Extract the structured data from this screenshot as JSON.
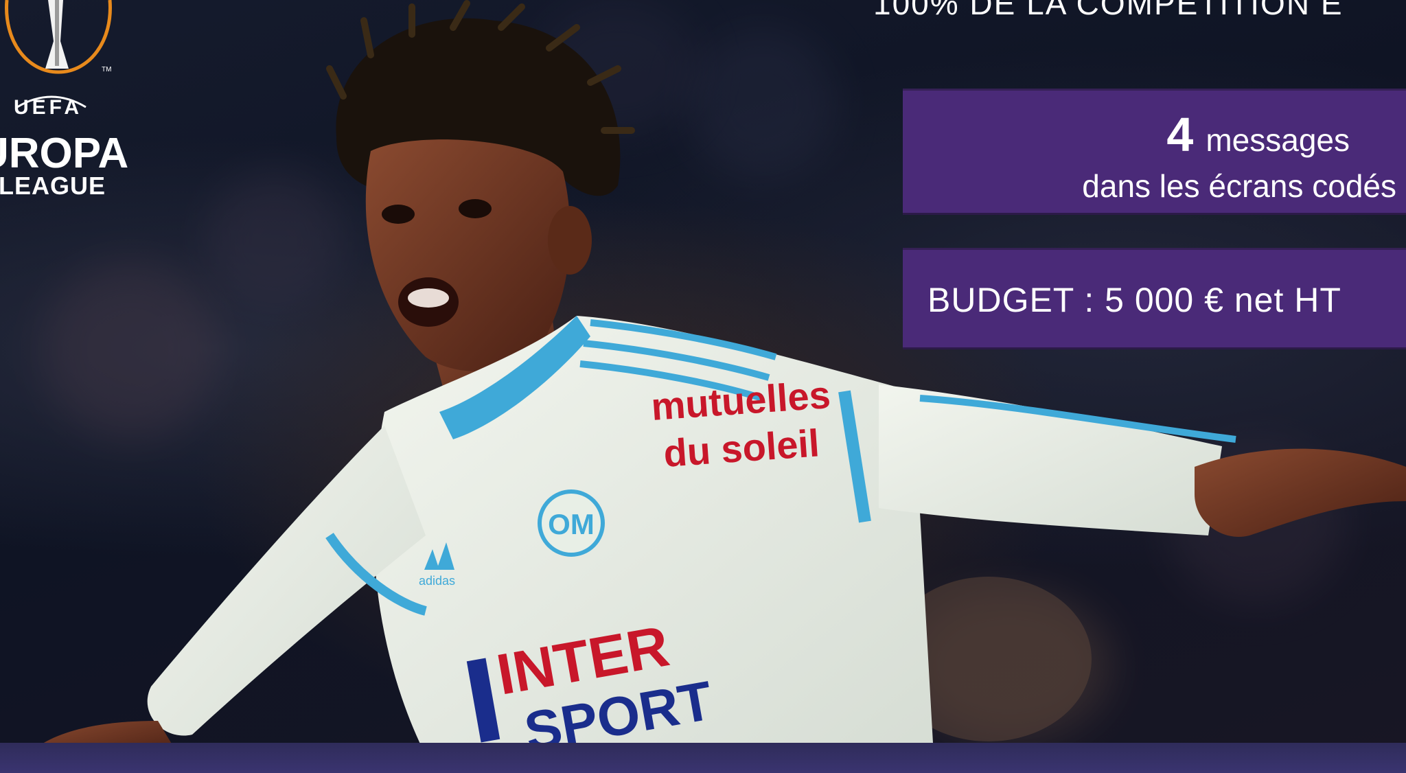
{
  "logo": {
    "uefa": "UEFA",
    "europa": "UROPA",
    "league": "LEAGUE",
    "tm": "TM",
    "icon": "trophy-icon"
  },
  "headline": "100% DE LA COMPETITION E",
  "messages_panel": {
    "count": "4",
    "word": "messages",
    "subtitle": "dans les écrans codés"
  },
  "budget_panel": {
    "text": "BUDGET : 5 000 € net HT"
  },
  "jersey": {
    "sponsor_top_1": "mutuelles",
    "sponsor_top_2": "du soleil",
    "sponsor_bottom_1": "INTER",
    "sponsor_bottom_2": "SPORT",
    "brand": "adidas"
  },
  "colors": {
    "panel_purple": "#4a2a78",
    "jersey_white": "#e8efe6",
    "jersey_blue": "#3fa9d8",
    "sponsor_red": "#c8172a",
    "sponsor_navy": "#1a2d8c"
  }
}
